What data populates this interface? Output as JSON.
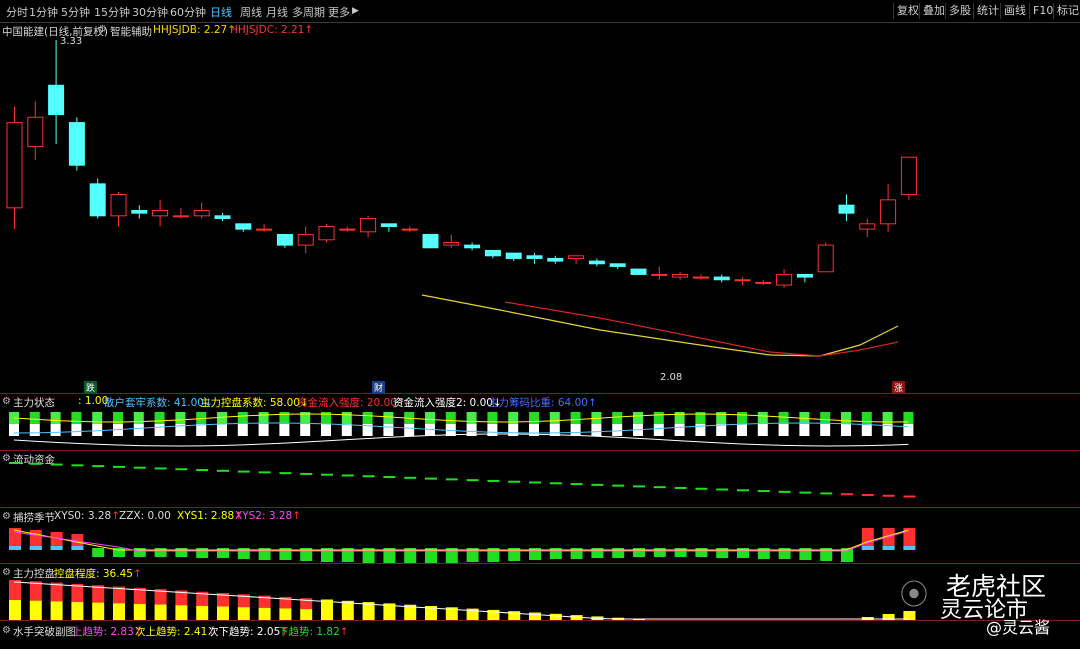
{
  "toolbar": {
    "periods": [
      "分时",
      "1分钟",
      "5分钟",
      "15分钟",
      "30分钟",
      "60分钟",
      "日线",
      "周线",
      "月线",
      "多周期",
      "更多"
    ],
    "active_period": "日线",
    "right_buttons": [
      "复权",
      "叠加",
      "多股",
      "统计",
      "画线",
      "F10",
      "标记"
    ]
  },
  "main_chart": {
    "stock_label": "中国能建(日线,前复权)",
    "indicator_name": "智能辅助",
    "hhjsjdb": "HHJSJDB: 2.27",
    "hhjsjdc": "HHJSJDC: 2.21",
    "high_marker": "3.33",
    "low_marker": "2.08",
    "signals": [
      "跌",
      "财",
      "涨"
    ]
  },
  "panel1": {
    "title": "主力状态",
    "v1": ": 1.00",
    "v2": "散户套牢系数: 41.00",
    "v3": "主力控盘系数: 58.00",
    "v4": "资金流入强度: 20.00",
    "v5": "资金流入强度2: 0.00",
    "v6": "主力筹码比重: 64.00"
  },
  "panel2": {
    "title": "流动资金"
  },
  "panel3": {
    "title": "捕捞季节",
    "xys0": "XYS0: 3.28",
    "zzx": "ZZX: 0.00",
    "xys1": "XYS1: 2.88",
    "xys2": "XYS2: 3.28"
  },
  "panel4": {
    "title": "主力控盘",
    "degree": "控盘程度: 36.45"
  },
  "panel5": {
    "title": "水手突破副图",
    "t1": "上趋势: 2.83",
    "t2": "次上趋势: 2.41",
    "t3": "次下趋势: 2.05",
    "t4": "下趋势: 1.82"
  },
  "watermark": {
    "line1": "老虎社区",
    "line2": "灵云论市",
    "handle": "@灵云酱"
  },
  "colors": {
    "up": "#ff3030",
    "down": "#54ffff",
    "green": "#22dd22",
    "yellow": "#ffff00",
    "magenta": "#ff44ff",
    "blue": "#4fc3ff"
  },
  "candles": [
    [
      2.7,
      3.02,
      2.62,
      3.08
    ],
    [
      2.93,
      3.04,
      2.88,
      3.1
    ],
    [
      3.16,
      3.05,
      2.94,
      3.33
    ],
    [
      3.02,
      2.86,
      2.84,
      3.04
    ],
    [
      2.79,
      2.67,
      2.66,
      2.81
    ],
    [
      2.67,
      2.75,
      2.63,
      2.76
    ],
    [
      2.69,
      2.68,
      2.66,
      2.71
    ],
    [
      2.67,
      2.69,
      2.63,
      2.73
    ],
    [
      2.67,
      2.67,
      2.66,
      2.7
    ],
    [
      2.67,
      2.69,
      2.66,
      2.72
    ],
    [
      2.67,
      2.66,
      2.65,
      2.68
    ],
    [
      2.64,
      2.62,
      2.61,
      2.64
    ],
    [
      2.62,
      2.62,
      2.61,
      2.64
    ],
    [
      2.6,
      2.56,
      2.55,
      2.6
    ],
    [
      2.56,
      2.6,
      2.53,
      2.63
    ],
    [
      2.58,
      2.63,
      2.57,
      2.64
    ],
    [
      2.62,
      2.62,
      2.61,
      2.63
    ],
    [
      2.61,
      2.66,
      2.59,
      2.67
    ],
    [
      2.64,
      2.63,
      2.61,
      2.64
    ],
    [
      2.62,
      2.62,
      2.61,
      2.63
    ],
    [
      2.6,
      2.55,
      2.55,
      2.6
    ],
    [
      2.56,
      2.57,
      2.55,
      2.6
    ],
    [
      2.56,
      2.55,
      2.54,
      2.57
    ],
    [
      2.54,
      2.52,
      2.51,
      2.54
    ],
    [
      2.53,
      2.51,
      2.5,
      2.53
    ],
    [
      2.52,
      2.51,
      2.49,
      2.53
    ],
    [
      2.51,
      2.5,
      2.49,
      2.52
    ],
    [
      2.51,
      2.52,
      2.49,
      2.52
    ],
    [
      2.5,
      2.49,
      2.48,
      2.51
    ],
    [
      2.49,
      2.48,
      2.47,
      2.49
    ],
    [
      2.47,
      2.45,
      2.45,
      2.47
    ],
    [
      2.45,
      2.45,
      2.43,
      2.48
    ],
    [
      2.44,
      2.45,
      2.43,
      2.46
    ],
    [
      2.44,
      2.44,
      2.43,
      2.45
    ],
    [
      2.44,
      2.43,
      2.42,
      2.45
    ],
    [
      2.43,
      2.43,
      2.41,
      2.44
    ],
    [
      2.42,
      2.42,
      2.41,
      2.43
    ],
    [
      2.41,
      2.45,
      2.4,
      2.47
    ],
    [
      2.45,
      2.44,
      2.42,
      2.45
    ],
    [
      2.46,
      2.56,
      2.46,
      2.57
    ],
    [
      2.71,
      2.68,
      2.65,
      2.75
    ],
    [
      2.62,
      2.64,
      2.59,
      2.66
    ],
    [
      2.64,
      2.73,
      2.61,
      2.79
    ],
    [
      2.75,
      2.89,
      2.73,
      2.89
    ]
  ]
}
